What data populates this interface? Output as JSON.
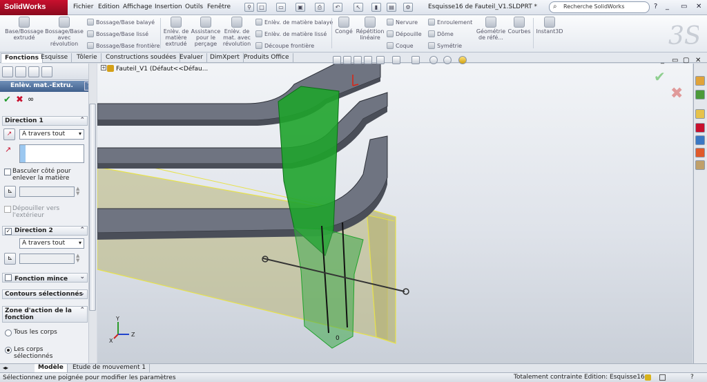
{
  "app": {
    "logo": "SolidWorks",
    "window_title": "Esquisse16 de Fauteil_V1.SLDPRT *"
  },
  "menu": [
    "Fichier",
    "Edition",
    "Affichage",
    "Insertion",
    "Outils",
    "Fenêtre"
  ],
  "search": {
    "placeholder": "Recherche SolidWorks"
  },
  "window_controls": [
    "?",
    "_",
    "▭",
    "✕"
  ],
  "ribbon": {
    "big": [
      {
        "label": "Base/Bossage extrudé",
        "icon": "extrude-boss-icon"
      },
      {
        "label": "Bossage/Base avec révolution",
        "icon": "revolve-boss-icon"
      },
      {
        "label": "Enlèv. de matière extrudé",
        "icon": "extruded-cut-icon"
      },
      {
        "label": "Assistance pour le perçage",
        "icon": "hole-wizard-icon"
      },
      {
        "label": "Enlèv. de mat. avec révolution",
        "icon": "revolved-cut-icon"
      },
      {
        "label": "Congé",
        "icon": "fillet-icon"
      },
      {
        "label": "Répétition linéaire",
        "icon": "linear-pattern-icon"
      },
      {
        "label": "Géométrie de réfé...",
        "icon": "reference-geometry-icon"
      },
      {
        "label": "Courbes",
        "icon": "curves-icon"
      },
      {
        "label": "Instant3D",
        "icon": "instant3d-icon"
      }
    ],
    "small": [
      {
        "label": "Bossage/Base balayé",
        "icon": "swept-boss-icon"
      },
      {
        "label": "Bossage/Base lissé",
        "icon": "lofted-boss-icon"
      },
      {
        "label": "Bossage/Base frontière",
        "icon": "boundary-boss-icon"
      },
      {
        "label": "Enlèv. de matière balayé",
        "icon": "swept-cut-icon"
      },
      {
        "label": "Enlèv. de matière lissé",
        "icon": "lofted-cut-icon"
      },
      {
        "label": "Découpe frontière",
        "icon": "boundary-cut-icon"
      },
      {
        "label": "Nervure",
        "icon": "rib-icon"
      },
      {
        "label": "Dépouille",
        "icon": "draft-icon"
      },
      {
        "label": "Coque",
        "icon": "shell-icon"
      },
      {
        "label": "Enroulement",
        "icon": "wrap-icon"
      },
      {
        "label": "Dôme",
        "icon": "dome-icon"
      },
      {
        "label": "Symétrie",
        "icon": "mirror-icon"
      }
    ]
  },
  "tabs": [
    "Fonctions",
    "Esquisse",
    "Tôlerie",
    "Constructions soudées",
    "Evaluer",
    "DimXpert",
    "Produits Office"
  ],
  "property_manager": {
    "title": "Enlèv. mat.-Extru.",
    "help": "?",
    "direction1": {
      "title": "Direction 1",
      "end_condition": "A travers tout",
      "flip_label": "Basculer côté pour enlever la matière",
      "draft_label": "Dépouiller vers l'extérieur"
    },
    "direction2": {
      "title": "Direction 2",
      "end_condition": "A travers tout"
    },
    "thin_feature": "Fonction mince",
    "contours": "Contours sélectionnés",
    "scope": {
      "title": "Zone d'action de la fonction",
      "all_bodies": "Tous les corps",
      "selected_bodies": "Les corps sélectionnés"
    }
  },
  "tree": {
    "root": "Fauteil_V1  (Défaut<<Défau..."
  },
  "viewport": {
    "dim_label": "0"
  },
  "axes": {
    "x": "X",
    "y": "Y",
    "z": "Z"
  },
  "bottom_tabs": [
    "Modèle",
    "Etude de mouvement 1"
  ],
  "status": {
    "message": "Sélectionnez une poignée pour modifier les paramètres",
    "constraint": "Totalement contrainte",
    "editing": "Edition: Esquisse16"
  },
  "colors": {
    "accent": "#c8102e",
    "feature_green": "#1fa32c",
    "plane_yellow": "#e7e24a",
    "body_gray": "#6f7481"
  }
}
